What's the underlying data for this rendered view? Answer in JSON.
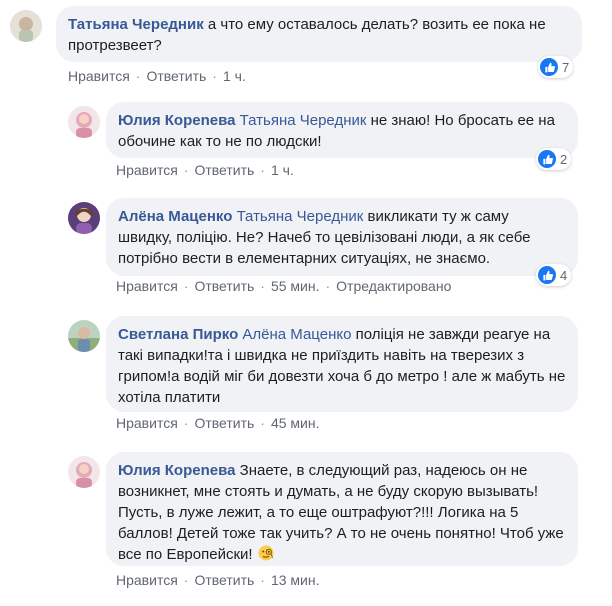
{
  "colors": {
    "link": "#385898",
    "bubble": "#f0f2f5",
    "like": "#1877f2",
    "meta": "#606770"
  },
  "comments": [
    {
      "author": "Татьяна Чередник",
      "mention": "",
      "text": "а что ему оставалось делать? возить ее пока не протрезвеет?",
      "like_label": "Нравится",
      "reply_label": "Ответить",
      "time": "1 ч.",
      "edited": "",
      "reactions": "7",
      "reaction_icon": "like-icon"
    },
    {
      "author": "Юлия Кореnева",
      "mention": "Татьяна Чередник",
      "text": "не знаю! Но бросать ее на обочине как то не по людски!",
      "like_label": "Нравится",
      "reply_label": "Ответить",
      "time": "1 ч.",
      "edited": "",
      "reactions": "2",
      "reaction_icon": "like-icon"
    },
    {
      "author": "Алёна Маценко",
      "mention": "Татьяна Чередник",
      "text": "викликати ту ж саму швидку, поліцію. Не? Начеб то цевілізовані люди, а як себе потрібно вести в елементарних ситуаціях, не знаємо.",
      "like_label": "Нравится",
      "reply_label": "Ответить",
      "time": "55 мин.",
      "edited": "Отредактировано",
      "reactions": "4",
      "reaction_icon": "like-icon"
    },
    {
      "author": "Светлана Пирко",
      "mention": "Алёна Маценко",
      "text": "поліція не завжди реагуе на такі випадки!та і швидка не приїздить навіть на тверезих з грипом!а водій міг би довезти хоча б до метро ! але ж мабуть не хотіла платити",
      "like_label": "Нравится",
      "reply_label": "Ответить",
      "time": "45 мин.",
      "edited": "",
      "reactions": "",
      "reaction_icon": ""
    },
    {
      "author": "Юлия Кореnева",
      "mention": "",
      "text": "Знаете, в следующий раз, надеюсь он не возникнет, мне стоять и думать, а не буду скорую вызывать! Пусть, в луже лежит, а то еще оштрафуют?!!! Логика на 5 баллов! Детей тоже так учить? А то не очень понятно! Чтоб уже все по Европейски!",
      "emoji": "monocle-face-icon",
      "like_label": "Нравится",
      "reply_label": "Ответить",
      "time": "13 мин.",
      "edited": "",
      "reactions": "",
      "reaction_icon": ""
    }
  ]
}
